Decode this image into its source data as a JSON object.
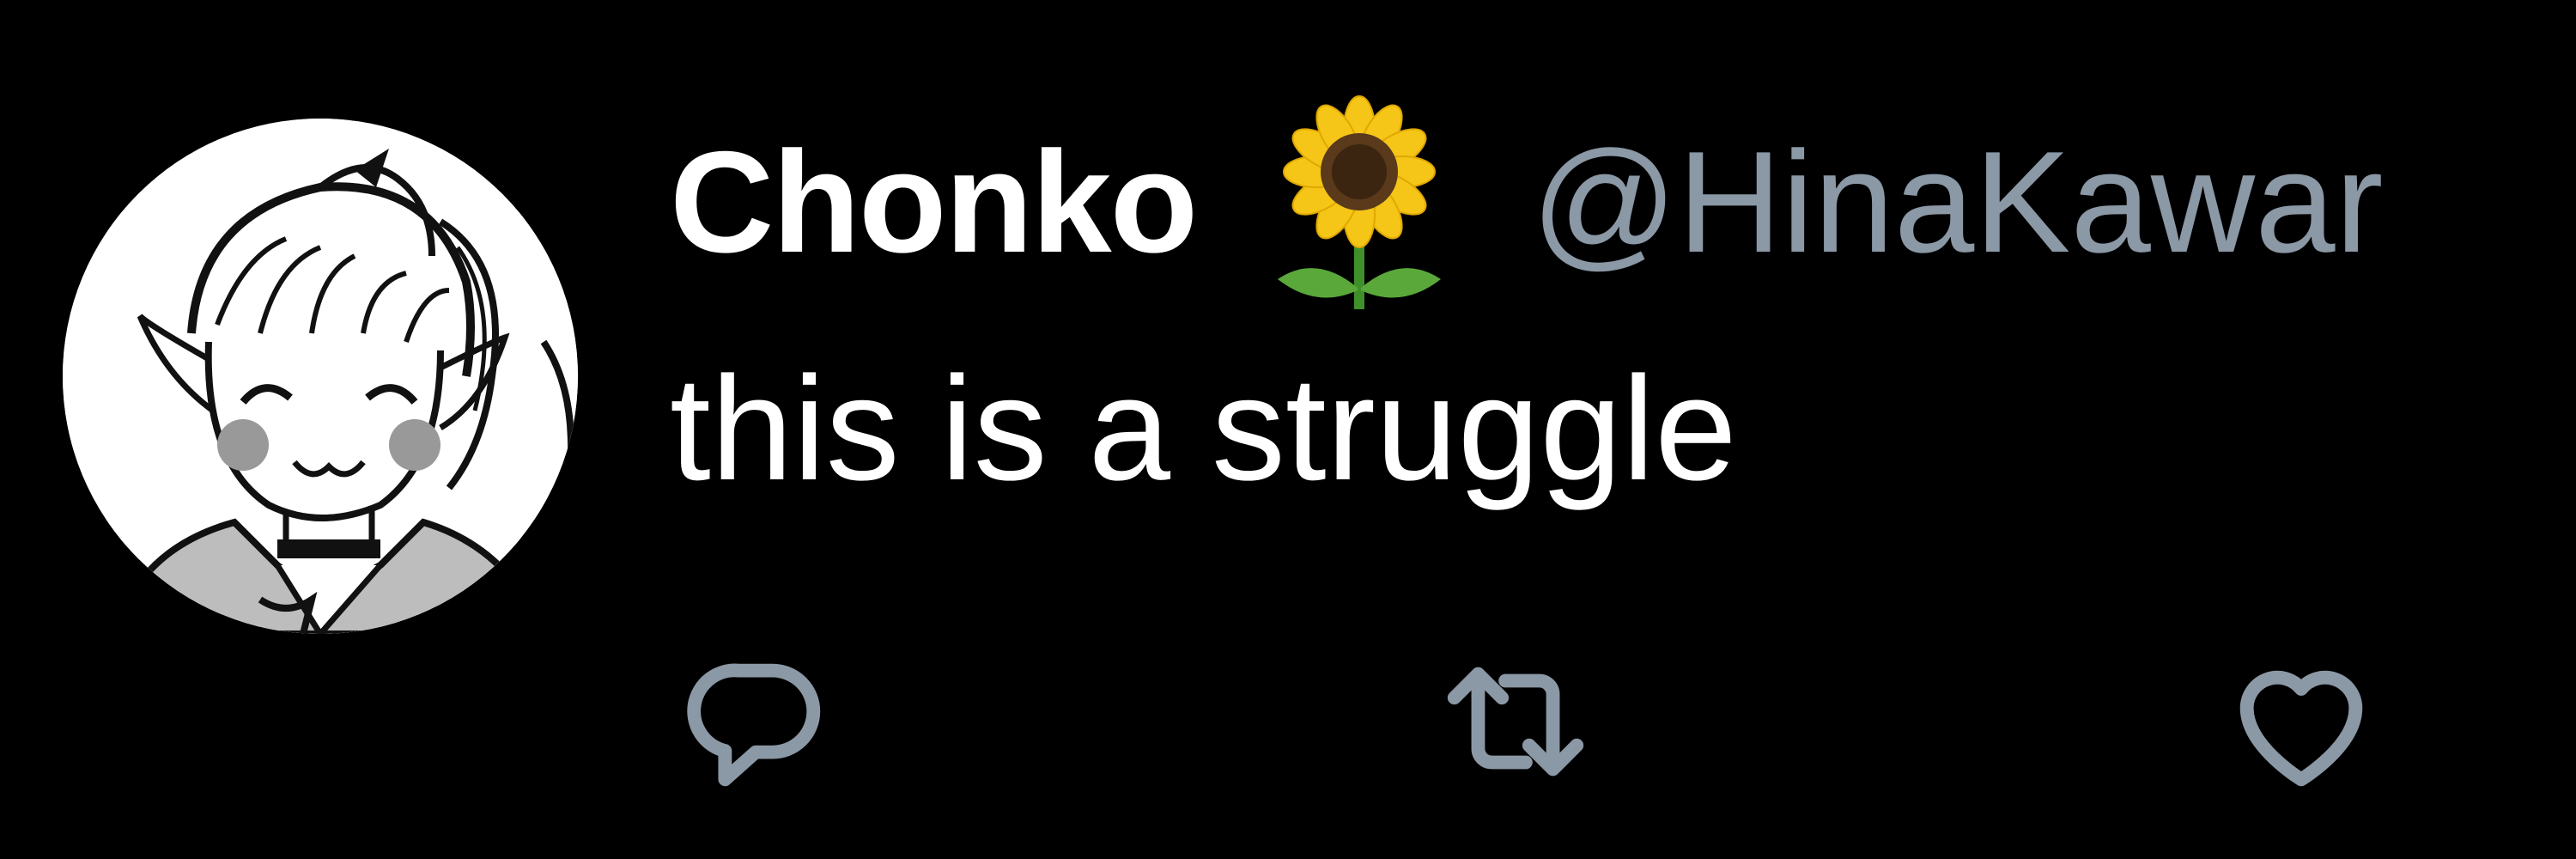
{
  "tweet": {
    "display_name": "Chonko",
    "name_emoji": "sunflower-emoji",
    "handle": "@HinaKawar",
    "text": "this is a struggle"
  },
  "actions": {
    "reply_icon": "reply-icon",
    "retweet_icon": "retweet-icon",
    "like_icon": "heart-icon"
  },
  "colors": {
    "background": "#000000",
    "text_primary": "#ffffff",
    "text_secondary": "#8b98a5",
    "icon": "#8b98a5"
  }
}
